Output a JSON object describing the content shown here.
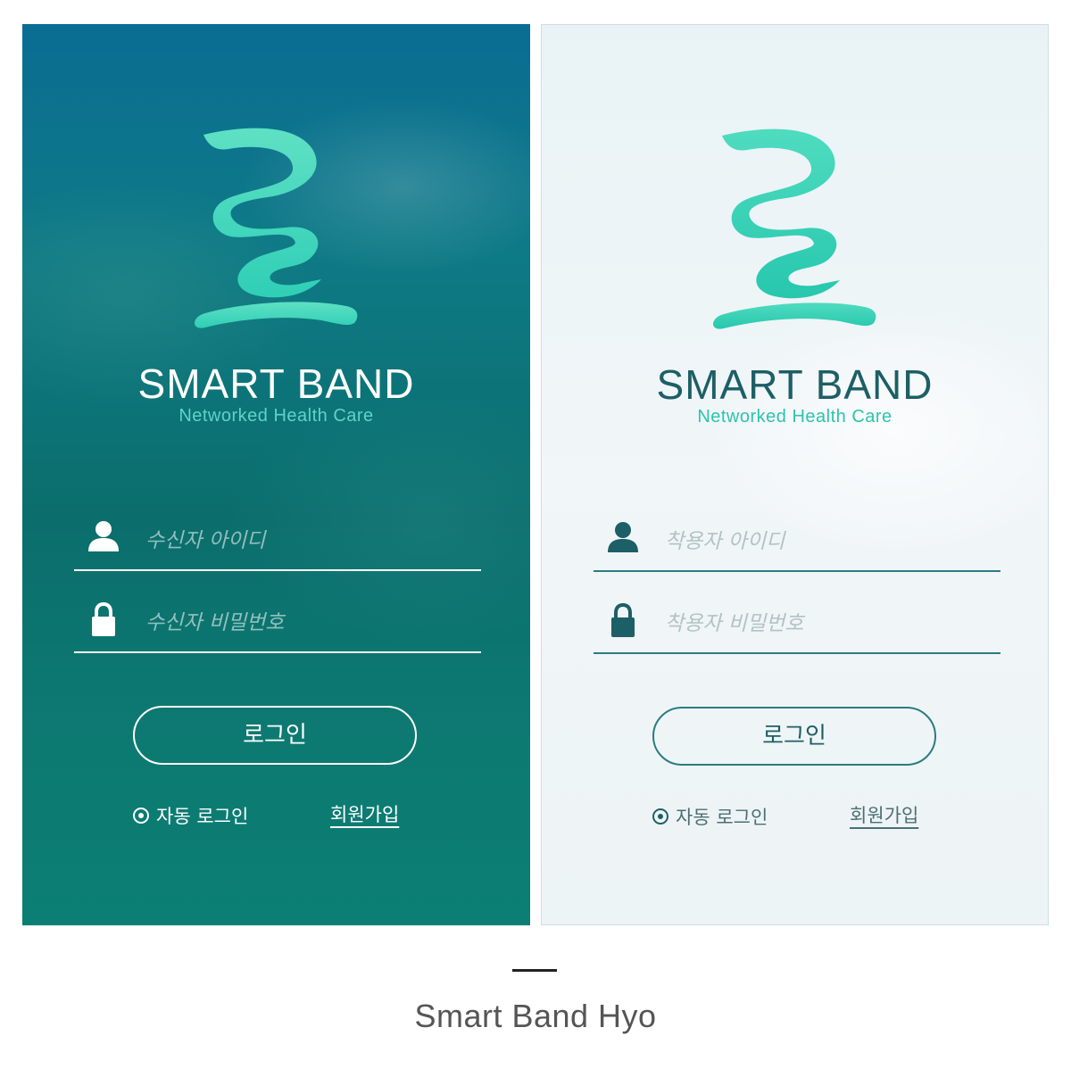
{
  "screens": [
    {
      "theme": "dark",
      "brand_title": "SMART BAND",
      "brand_subtitle": "Networked Health Care",
      "id_placeholder": "수신자 아이디",
      "password_placeholder": "수신자 비밀번호",
      "login_label": "로그인",
      "auto_login_label": "자동 로그인",
      "signup_label": "회원가입"
    },
    {
      "theme": "light",
      "brand_title": "SMART BAND",
      "brand_subtitle": "Networked Health Care",
      "id_placeholder": "착용자 아이디",
      "password_placeholder": "착용자 비밀번호",
      "login_label": "로그인",
      "auto_login_label": "자동 로그인",
      "signup_label": "회원가입"
    }
  ],
  "caption": "Smart Band Hyo",
  "colors": {
    "accent_mint": "#35d3b6",
    "dark_teal": "#0b6e6c",
    "light_teal_text": "#1d5f66"
  }
}
